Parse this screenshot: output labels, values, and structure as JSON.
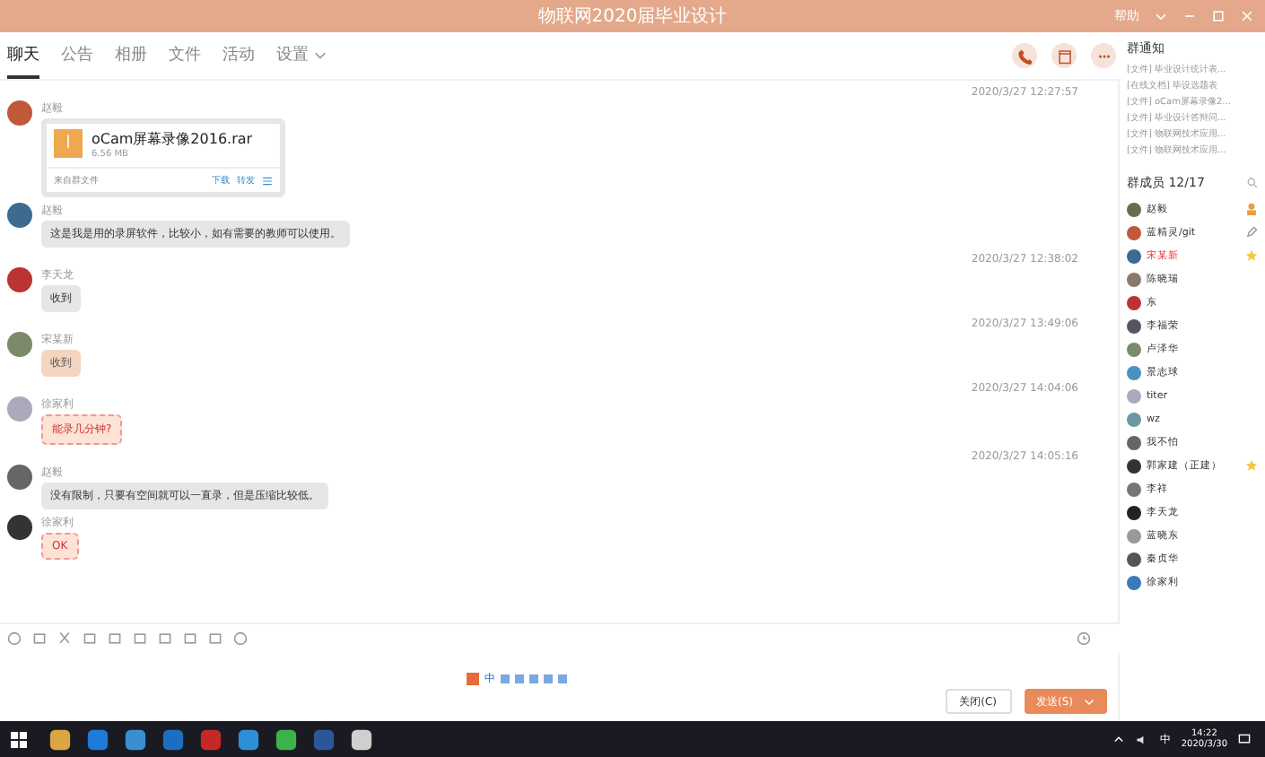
{
  "window": {
    "title": "物联网2020届毕业设计",
    "help": "帮助"
  },
  "tabs": [
    {
      "label": "聊天",
      "selected": true
    },
    {
      "label": "公告",
      "selected": false
    },
    {
      "label": "相册",
      "selected": false
    },
    {
      "label": "文件",
      "selected": false
    },
    {
      "label": "活动",
      "selected": false
    },
    {
      "label": "设置",
      "selected": false
    }
  ],
  "messages": [
    {
      "kind": "time",
      "text": "2020/3/27 12:27:57"
    },
    {
      "kind": "file",
      "sender": "赵毅",
      "file_name": "oCam屏幕录像2016.rar",
      "size": "6.56 MB",
      "source": "来自群文件",
      "actions": [
        "下载",
        "转发"
      ]
    },
    {
      "kind": "gray",
      "sender": "赵毅",
      "text": "这是我是用的录屏软件，比较小，如有需要的教师可以使用。"
    },
    {
      "kind": "time",
      "text": "2020/3/27 12:38:02"
    },
    {
      "kind": "gray",
      "sender": "李天龙",
      "text": "收到"
    },
    {
      "kind": "time",
      "text": "2020/3/27 13:49:06"
    },
    {
      "kind": "peach",
      "sender": "宋某新",
      "text": "收到"
    },
    {
      "kind": "time",
      "text": "2020/3/27 14:04:06"
    },
    {
      "kind": "note",
      "sender": "徐家利",
      "text": "能录几分钟?"
    },
    {
      "kind": "time",
      "text": "2020/3/27 14:05:16"
    },
    {
      "kind": "gray",
      "sender": "赵毅",
      "text": "没有限制，只要有空间就可以一直录，但是压缩比较低。"
    },
    {
      "kind": "note",
      "sender": "徐家利",
      "text": "OK"
    }
  ],
  "notices": {
    "title": "群通知",
    "items": [
      "[文件] 毕业设计统计表...",
      "[在线文档] 毕设选题表",
      "[文件] oCam屏幕录像2...",
      "[文件] 毕业设计答辩问...",
      "[文件] 物联网技术应用...",
      "[文件] 物联网技术应用..."
    ]
  },
  "members": {
    "title": "群成员 12/17",
    "items": [
      {
        "kind": "owner",
        "name": "赵毅",
        "highlighted": false
      },
      {
        "kind": "editor",
        "name": "蓝精灵/git",
        "highlighted": false
      },
      {
        "kind": "starred",
        "name": "宋某新",
        "highlighted": true
      },
      {
        "kind": "plain",
        "name": "陈晓瑞",
        "highlighted": false
      },
      {
        "kind": "plain",
        "name": "东",
        "highlighted": false
      },
      {
        "kind": "plain",
        "name": "李福荣",
        "highlighted": false
      },
      {
        "kind": "plain",
        "name": "卢泽华",
        "highlighted": false
      },
      {
        "kind": "plain",
        "name": "景志球",
        "highlighted": false
      },
      {
        "kind": "plain",
        "name": "titer",
        "highlighted": false
      },
      {
        "kind": "plain",
        "name": "wz",
        "highlighted": false
      },
      {
        "kind": "plain",
        "name": "我不怕",
        "highlighted": false
      },
      {
        "kind": "starred",
        "name": "郭家建（正建）",
        "highlighted": false
      },
      {
        "kind": "plain",
        "name": "李祥",
        "highlighted": false
      },
      {
        "kind": "plain",
        "name": "李天龙",
        "highlighted": false
      },
      {
        "kind": "plain",
        "name": "蓝晓东",
        "highlighted": false
      },
      {
        "kind": "plain",
        "name": "秦贞华",
        "highlighted": false
      },
      {
        "kind": "plain",
        "name": "徐家利",
        "highlighted": false
      }
    ]
  },
  "buttons": {
    "close": "关闭(C)",
    "send": "发送(S)"
  },
  "ime": {
    "label": "中"
  },
  "taskbar": {
    "ime": "中",
    "time": "14:22",
    "date": "2020/3/30"
  }
}
